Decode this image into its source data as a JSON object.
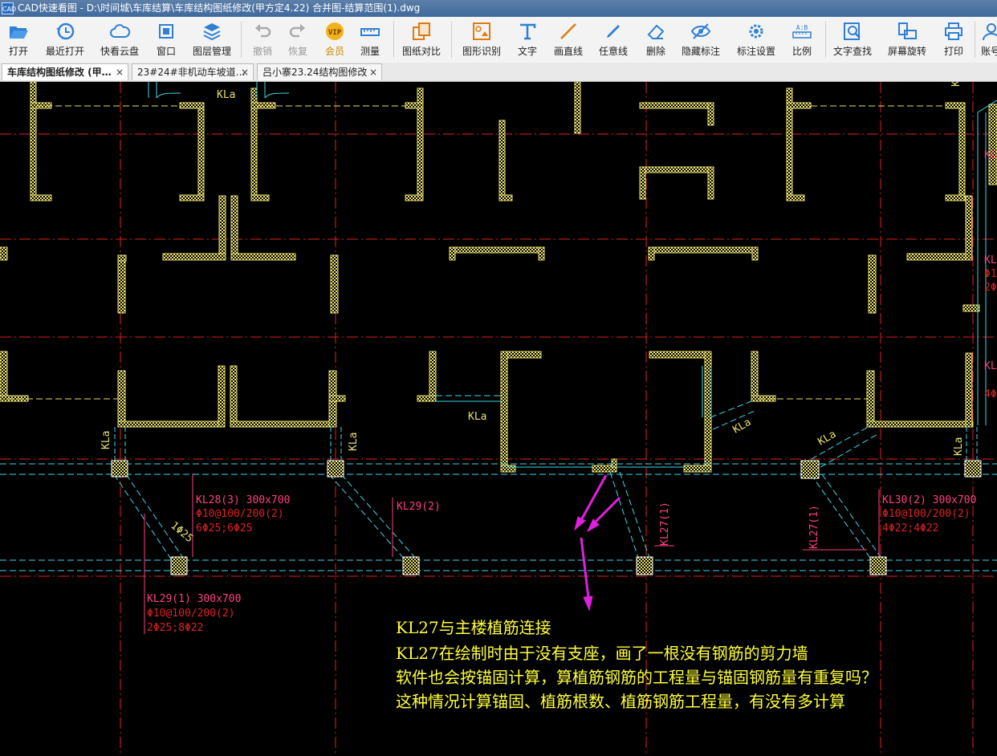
{
  "window": {
    "app_icon": "CAD",
    "title": "CAD快速看图 - D:\\时间城\\车库结算\\车库结构图纸修改(甲方定4.22) 合并图-结算范围(1).dwg"
  },
  "toolbar": {
    "items": [
      {
        "label": "打开",
        "icon": "folder-open-icon"
      },
      {
        "label": "最近打开",
        "icon": "history-icon"
      },
      {
        "label": "快看云盘",
        "icon": "cloud-icon"
      },
      {
        "label": "窗口",
        "icon": "window-icon"
      },
      {
        "label": "图层管理",
        "icon": "layers-icon"
      },
      {
        "label": "撤销",
        "icon": "undo-icon"
      },
      {
        "label": "恢复",
        "icon": "redo-icon"
      },
      {
        "label": "会员",
        "icon": "vip-icon"
      },
      {
        "label": "测量",
        "icon": "ruler-icon"
      },
      {
        "label": "图纸对比",
        "icon": "compare-icon"
      },
      {
        "label": "图形识别",
        "icon": "shape-recognize-icon"
      },
      {
        "label": "文字",
        "icon": "text-icon"
      },
      {
        "label": "画直线",
        "icon": "line-icon"
      },
      {
        "label": "任意线",
        "icon": "pen-icon"
      },
      {
        "label": "删除",
        "icon": "eraser-icon"
      },
      {
        "label": "隐藏标注",
        "icon": "eye-hide-icon"
      },
      {
        "label": "标注设置",
        "icon": "settings-icon"
      },
      {
        "label": "比例",
        "icon": "scale-icon"
      },
      {
        "label": "文字查找",
        "icon": "text-search-icon"
      },
      {
        "label": "屏幕旋转",
        "icon": "rotate-icon"
      },
      {
        "label": "打印",
        "icon": "printer-icon"
      },
      {
        "label": "账号",
        "icon": "user-icon"
      }
    ]
  },
  "tabs": [
    {
      "label": "车库结构图纸修改 (甲…",
      "close": "×",
      "active": true
    },
    {
      "label": "23#24#非机动车坡道…",
      "close": "×",
      "active": false
    },
    {
      "label": "吕小寨23.24结构图修改",
      "close": "×",
      "active": false
    }
  ],
  "drawing": {
    "kla_label": "KLa",
    "rebar_label": "1Φ25",
    "beams": {
      "kl28": {
        "name": "KL28(3) 300x700",
        "stirrup": "Φ10@100/200(2)",
        "bars": "6Φ25;6Φ25"
      },
      "kl29_2": {
        "name": "KL29(2)"
      },
      "kl29_1": {
        "name": "KL29(1) 300x700",
        "stirrup": "Φ10@100/200(2)",
        "bars": "2Φ25;8Φ22"
      },
      "kl27": {
        "name": "KL27(1)"
      },
      "kl30": {
        "name": "KL30(2) 300x700",
        "stirrup": "Φ10@100/200(2)",
        "bars": "4Φ22;4Φ22"
      }
    },
    "edge_labels": {
      "kl": "KL",
      "phi_fragment": "Φ1",
      "two_phi": "2Φ",
      "four_phi": "4Φ"
    },
    "colors": {
      "wall": "#e8e070",
      "beam": "#3cd8e8",
      "axis": "#e02020",
      "dim": "#ff4080",
      "arrow": "#e020e0",
      "note": "#ffff3a"
    }
  },
  "notes": [
    "KL27与主楼植筋连接",
    "KL27在绘制时由于没有支座，画了一根没有钢筋的剪力墙",
    "软件也会按锚固计算，算植筋钢筋的工程量与锚固钢筋量有重复吗？",
    "这种情况计算锚固、植筋根数、植筋钢筋工程量，有没有多计算"
  ]
}
